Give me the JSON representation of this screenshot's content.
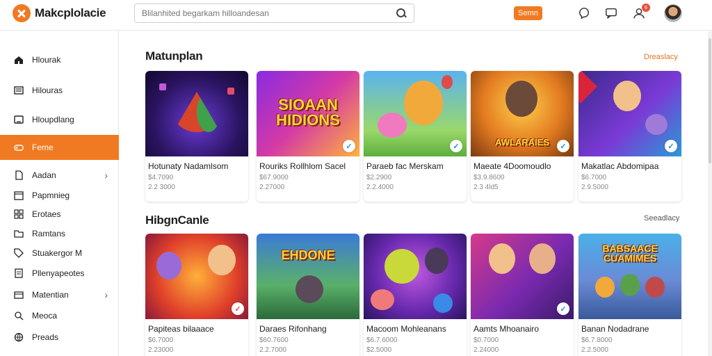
{
  "header": {
    "logo_text": "Makcplolacie",
    "search_placeholder": "Blilanhited begarkam hilloandesan",
    "signin_label": "Semn",
    "notification_count": "6"
  },
  "sidebar": {
    "items": [
      {
        "label": "Hlourak",
        "icon": "home-icon"
      },
      {
        "label": "Hilouras",
        "icon": "list-icon"
      },
      {
        "label": "Hloupdlang",
        "icon": "tablet-icon"
      },
      {
        "label": "Feme",
        "icon": "gamepad-icon",
        "active": true
      },
      {
        "label": "Aadan",
        "icon": "doc-icon",
        "chevron": true
      },
      {
        "label": "Papmnieg",
        "icon": "calendar-icon"
      },
      {
        "label": "Erotaes",
        "icon": "grid-icon"
      },
      {
        "label": "Ramtans",
        "icon": "folder-icon"
      },
      {
        "label": "Stuakergor M",
        "icon": "tag-icon"
      },
      {
        "label": "Pllenyapeotes",
        "icon": "badge-icon"
      },
      {
        "label": "Matentian",
        "icon": "box-icon",
        "chevron": true
      },
      {
        "label": "Meoca",
        "icon": "pin-icon"
      },
      {
        "label": "Preads",
        "icon": "globe-icon"
      }
    ]
  },
  "sections": [
    {
      "title": "Matunplan",
      "see_all": "Dreaslacy",
      "cards": [
        {
          "title": "Hotunaty Nadamlsom",
          "meta1": "$4.7090",
          "meta2": "2.2 3000",
          "art": "",
          "check": true
        },
        {
          "title": "Rouriks Rollhlom Sacel",
          "meta1": "$67.9000",
          "meta2": "2.27000",
          "art": "SIOAAN HIDIONS",
          "check": true
        },
        {
          "title": "Paraeb fac Merskam",
          "meta1": "$2.2900",
          "meta2": "2.2.4000",
          "art": "",
          "check": true
        },
        {
          "title": "Maeate 4Doomoudlo",
          "meta1": "$3.9.8600",
          "meta2": "2.3 4ld5",
          "art": "AWLARAIES",
          "check": true
        },
        {
          "title": "Makatlac Abdomipaa",
          "meta1": "$6.7000",
          "meta2": "2.9.5000",
          "art": "",
          "check": true
        }
      ]
    },
    {
      "title": "HibgnCanle",
      "see_all": "Seeadlacy",
      "cards": [
        {
          "title": "Papiteas bilaaace",
          "meta1": "$6.7000",
          "meta2": "2.23000",
          "art": "",
          "check": true
        },
        {
          "title": "Daraes Rifonhang",
          "meta1": "$60.7600",
          "meta2": "2.2.7000",
          "art": "EHDONE",
          "check": false
        },
        {
          "title": "Macoom Mohleanans",
          "meta1": "$6.7.6000",
          "meta2": "$2.5000",
          "art": "",
          "check": false
        },
        {
          "title": "Aamts Mhoanairo",
          "meta1": "$0.7000",
          "meta2": "2.24000",
          "art": "",
          "check": true
        },
        {
          "title": "Banan Nodadrane",
          "meta1": "$6.7.8000",
          "meta2": "2.2.5000",
          "art": "BABSAACE CUAMIMES",
          "check": false
        }
      ]
    }
  ],
  "colors": {
    "accent": "#f07a22",
    "see_all_primary": "#e0741f"
  }
}
